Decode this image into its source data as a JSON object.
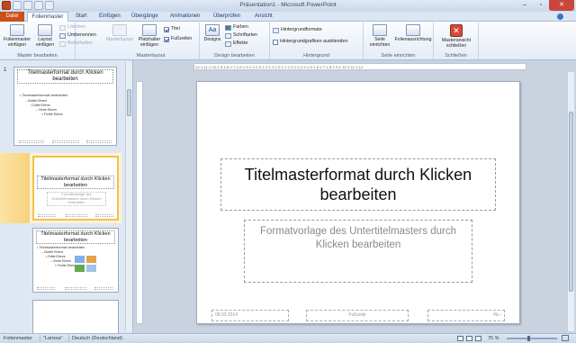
{
  "window": {
    "title": "Präsentation1 - Microsoft PowerPoint"
  },
  "tabs": {
    "file": "Datei",
    "active": "Folienmaster",
    "items": [
      "Start",
      "Einfügen",
      "Übergänge",
      "Animationen",
      "Überprüfen",
      "Ansicht"
    ]
  },
  "ribbon": {
    "master_edit": {
      "label": "Master bearbeiten",
      "insert_master": "Folienmaster einfügen",
      "insert_layout": "Layout einfügen",
      "delete": "Löschen",
      "rename": "Umbenennen",
      "preserve": "Beibehalten"
    },
    "master_layout": {
      "label": "Masterlayout",
      "master_layout_btn": "Masterlayout",
      "insert_placeholder": "Platzhalter einfügen",
      "title_cb": "Titel",
      "footer_cb": "Fußzeilen",
      "title_checked": true,
      "footer_checked": true
    },
    "design": {
      "label": "Design bearbeiten",
      "designs": "Designs",
      "colors": "Farben",
      "fonts": "Schriftarten",
      "effects": "Effekte"
    },
    "background": {
      "label": "Hintergrund",
      "bg_formats": "Hintergrundformate",
      "hide_bg": "Hintergrundgrafiken ausblenden"
    },
    "page_setup": {
      "label": "Seite einrichten",
      "setup": "Seite einrichten",
      "orientation": "Folienausrichtung"
    },
    "close_grp": {
      "label": "Schließen",
      "close_master": "Masteransicht schließen"
    }
  },
  "thumbnails": [
    {
      "number": "1",
      "title": "Titelmasterformat durch Klicken bearbeiten",
      "lines": [
        "• Textmasterformat bearbeiten",
        "– Zweite Ebene",
        "• Dritte Ebene",
        "– Vierte Ebene",
        "» Fünfte Ebene"
      ]
    },
    {
      "title": "Titelmasterformat durch Klicken bearbeiten",
      "subtitle": "Formatvorlage des Untertitelmasters durch Klicken bearbeiten"
    },
    {
      "title": "Titelmasterformat durch Klicken bearbeiten",
      "lines": [
        "• Textmasterformat bearbeiten",
        "– Zweite Ebene",
        "• Dritte Ebene",
        "– Vierte Ebene",
        "» Fünfte Ebene"
      ]
    }
  ],
  "slide": {
    "title": "Titelmasterformat durch Klicken bearbeiten",
    "subtitle": "Formatvorlage des Untertitelmasters durch Klicken bearbeiten",
    "date": "08.03.2014",
    "footer": "Fußzeile",
    "page_number": "‹Nr.›"
  },
  "ruler_text": "·12·1·11·1·10·1·9·1·8·1·7·1·6·1·5·1·4·1·3·1·2·1·1·1·0·1·1·1·2·1·3·1·4·1·5·1·6·1·7·1·8·1·9·1·10·1·11·1·12·",
  "status": {
    "view": "Folienmaster",
    "theme": "\"Larissa\"",
    "language": "Deutsch (Deutschland)",
    "zoom": "75 %"
  }
}
